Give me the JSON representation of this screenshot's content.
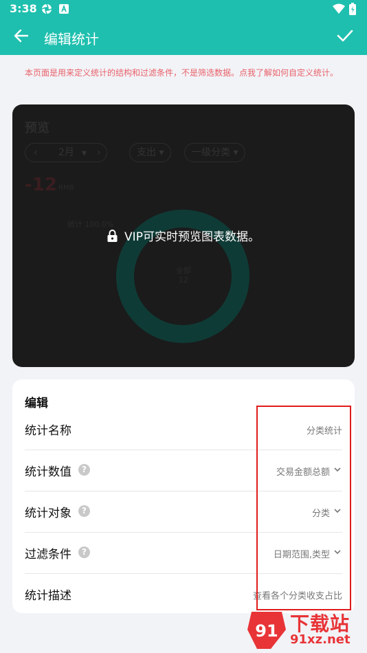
{
  "status_bar": {
    "time": "3:38"
  },
  "app_bar": {
    "title": "编辑统计"
  },
  "notice": "本页面是用来定义统计的结构和过滤条件，不是筛选数据。点我了解如何自定义统计。",
  "preview": {
    "title": "预览",
    "chips": {
      "prev": "‹",
      "month": "2月",
      "next": "›",
      "type": "支出",
      "category": "一级分类"
    },
    "amount": "-12",
    "amount_unit": "RMB",
    "total_label": "统计 100.0%",
    "ring_label": "全部",
    "ring_value": "12",
    "vip_message": "VIP可实时预览图表数据。"
  },
  "edit": {
    "title": "编辑",
    "rows": [
      {
        "label": "统计名称",
        "value": "分类统计",
        "help": false,
        "dropdown": false
      },
      {
        "label": "统计数值",
        "value": "交易金额总额",
        "help": true,
        "dropdown": true
      },
      {
        "label": "统计对象",
        "value": "分类",
        "help": true,
        "dropdown": true
      },
      {
        "label": "过滤条件",
        "value": "日期范围,类型",
        "help": true,
        "dropdown": true
      },
      {
        "label": "统计描述",
        "value": "查看各个分类收支占比",
        "help": false,
        "dropdown": false
      }
    ]
  },
  "watermark": {
    "line1": "下载站",
    "line2": "91xz.net",
    "logo_glyph": "91"
  },
  "colors": {
    "primary": "#1ebfae",
    "notice": "#e8626a",
    "highlight": "#e01b1b",
    "ring": "#0f3b36"
  }
}
